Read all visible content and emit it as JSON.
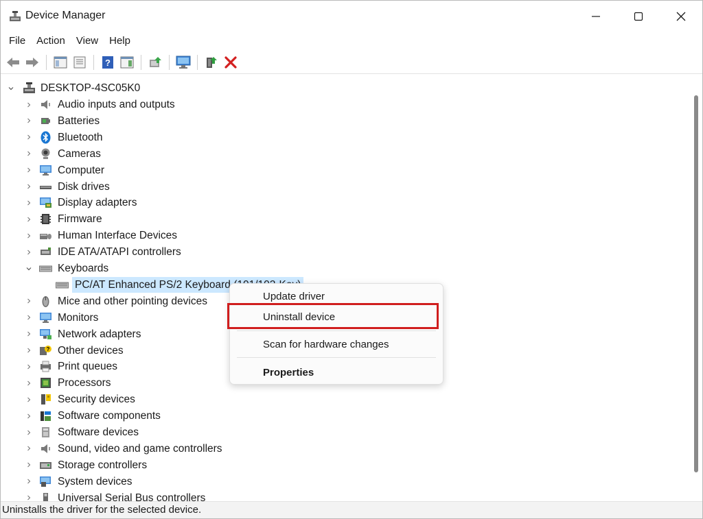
{
  "window": {
    "title": "Device Manager"
  },
  "menu": [
    "File",
    "Action",
    "View",
    "Help"
  ],
  "tree": {
    "root": "DESKTOP-4SC05K0",
    "items": [
      {
        "label": "Audio inputs and outputs",
        "icon": "speaker-icon"
      },
      {
        "label": "Batteries",
        "icon": "battery-icon"
      },
      {
        "label": "Bluetooth",
        "icon": "bluetooth-icon"
      },
      {
        "label": "Cameras",
        "icon": "camera-icon"
      },
      {
        "label": "Computer",
        "icon": "monitor-icon"
      },
      {
        "label": "Disk drives",
        "icon": "disk-drive-icon"
      },
      {
        "label": "Display adapters",
        "icon": "display-adapter-icon"
      },
      {
        "label": "Firmware",
        "icon": "chip-icon"
      },
      {
        "label": "Human Interface Devices",
        "icon": "hid-icon"
      },
      {
        "label": "IDE ATA/ATAPI controllers",
        "icon": "ide-controller-icon"
      },
      {
        "label": "Keyboards",
        "icon": "keyboard-icon",
        "expanded": true
      },
      {
        "label": "PC/AT Enhanced PS/2 Keyboard (101/102-Key)",
        "icon": "keyboard-icon",
        "child": true,
        "selected": true
      },
      {
        "label": "Mice and other pointing devices",
        "icon": "mouse-icon"
      },
      {
        "label": "Monitors",
        "icon": "monitor-icon"
      },
      {
        "label": "Network adapters",
        "icon": "network-adapter-icon"
      },
      {
        "label": "Other devices",
        "icon": "unknown-device-icon"
      },
      {
        "label": "Print queues",
        "icon": "printer-icon"
      },
      {
        "label": "Processors",
        "icon": "processor-icon"
      },
      {
        "label": "Security devices",
        "icon": "security-key-icon"
      },
      {
        "label": "Software components",
        "icon": "software-component-icon"
      },
      {
        "label": "Software devices",
        "icon": "software-device-icon"
      },
      {
        "label": "Sound, video and game controllers",
        "icon": "speaker-icon"
      },
      {
        "label": "Storage controllers",
        "icon": "storage-controller-icon"
      },
      {
        "label": "System devices",
        "icon": "system-device-icon"
      },
      {
        "label": "Universal Serial Bus controllers",
        "icon": "usb-icon"
      }
    ]
  },
  "context_menu": {
    "update": "Update driver",
    "uninstall": "Uninstall device",
    "scan": "Scan for hardware changes",
    "properties": "Properties"
  },
  "status_text": "Uninstalls the driver for the selected device.",
  "colors": {
    "highlight": "#d01e1e",
    "selection": "#cce8ff",
    "accent": "#1976d2"
  }
}
